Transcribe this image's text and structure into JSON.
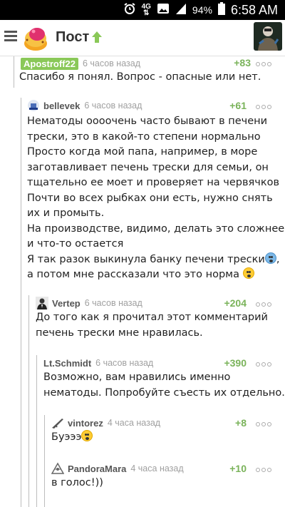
{
  "status": {
    "signal_label": "4G",
    "battery": "94%",
    "time": "6:58 AM"
  },
  "header": {
    "title": "Пост"
  },
  "comments": [
    {
      "user": "Apostroff22",
      "time": "6 часов назад",
      "rating": "+83",
      "lines": [
        "Спасибо я понял. Вопрос - опасные или нет."
      ]
    },
    {
      "user": "bellevek",
      "time": "6 часов назад",
      "rating": "+61",
      "lines": [
        "Нематоды оооочень часто бывают в печени",
        "трески, это в какой-то степени нормально",
        "Просто когда мой папа, например, в море",
        "заготавливает печень трески для семьи, он",
        "тщательно ее моет и проверяет на червячков",
        "Почти во всех рыбках они есть, нужно снять",
        "их и промыть.",
        "На производстве, видимо, делать это сложнее",
        "и что-то остается",
        "Я так разок выкинула банку печени трески",
        "а потом мне рассказали что это норма"
      ]
    },
    {
      "user": "Vertep",
      "time": "6 часов назад",
      "rating": "+204",
      "lines": [
        "До того как я прочитал этот комментарий",
        "печень трески мне нравилась."
      ]
    },
    {
      "user": "Lt.Schmidt",
      "time": "6 часов назад",
      "rating": "+390",
      "lines": [
        "Возможно, вам нравились именно",
        "нематоды. Попробуйте съесть их отдельно."
      ]
    },
    {
      "user": "vintorez",
      "time": "4 часа назад",
      "rating": "+8",
      "lines": [
        "Буэээ"
      ]
    },
    {
      "user": "PandoraMara",
      "time": "4 часа назад",
      "rating": "+10",
      "lines": [
        "в голос!))"
      ]
    }
  ]
}
